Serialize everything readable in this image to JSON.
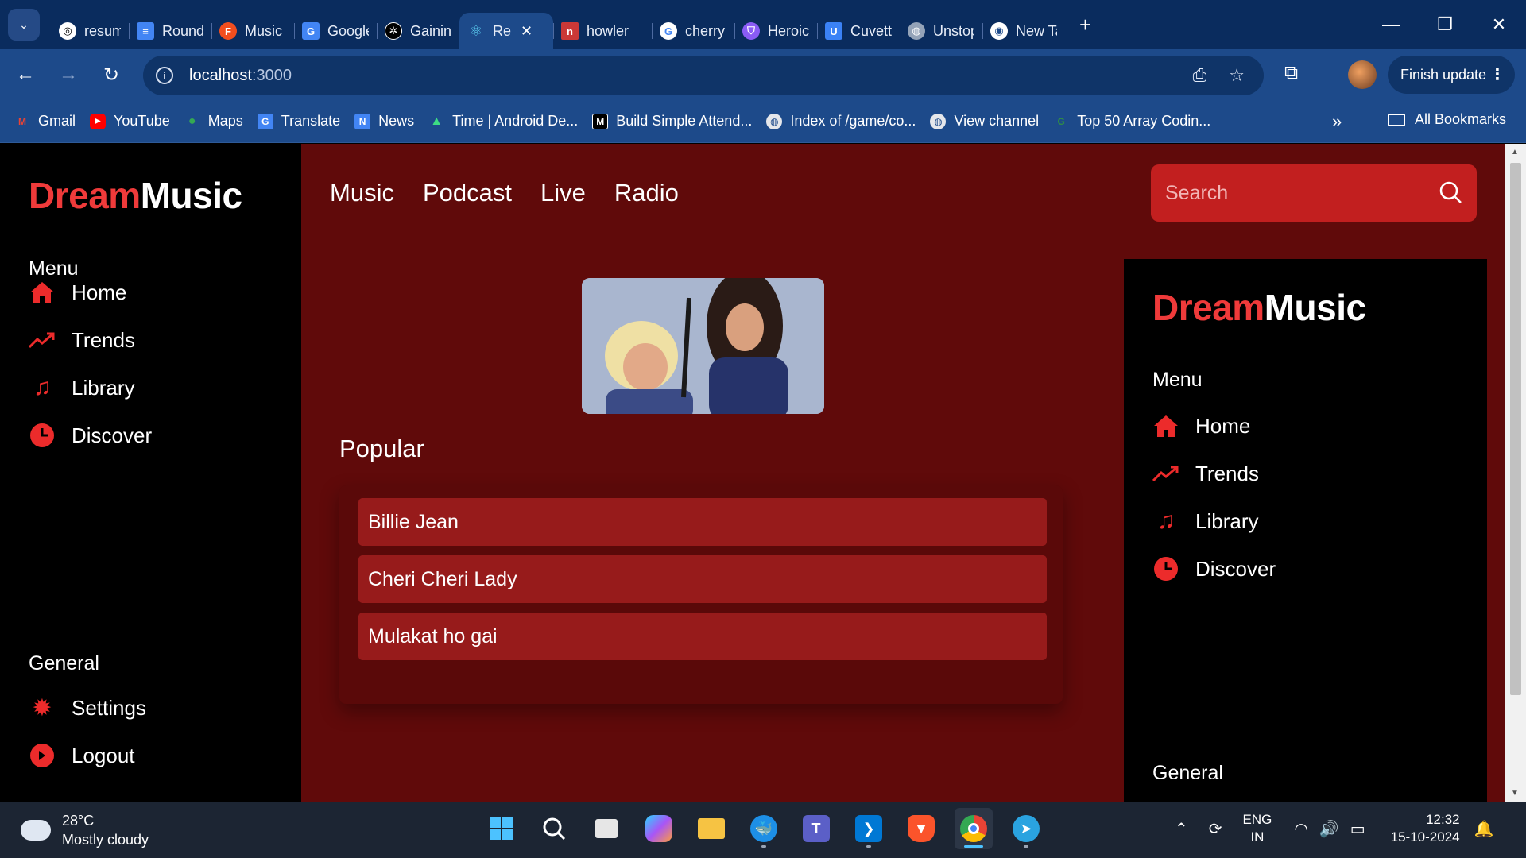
{
  "browser": {
    "tabs": [
      {
        "label": "resume",
        "favicon": "chatgpt-icon",
        "color": "#ffffff"
      },
      {
        "label": "Round",
        "favicon": "docs-icon",
        "color": "#4285f4"
      },
      {
        "label": "Music I",
        "favicon": "figma-icon",
        "color": "#f24e1e"
      },
      {
        "label": "Google",
        "favicon": "translate-icon",
        "color": "#4285f4"
      },
      {
        "label": "Gaining",
        "favicon": "openai-icon",
        "color": "#000000"
      },
      {
        "label": "Re",
        "favicon": "react-icon",
        "color": "#61dafb",
        "active": true
      },
      {
        "label": "howler",
        "favicon": "npm-icon",
        "color": "#cb3837"
      },
      {
        "label": "cherry",
        "favicon": "google-icon",
        "color": "#ffffff"
      },
      {
        "label": "Heroic",
        "favicon": "shield-icon",
        "color": "#8a5cf6"
      },
      {
        "label": "Cuvette",
        "favicon": "cuvette-icon",
        "color": "#3b82f6"
      },
      {
        "label": "Unstop",
        "favicon": "globe-icon",
        "color": "#94a3b8"
      },
      {
        "label": "New Ta",
        "favicon": "chrome-icon",
        "color": "#ffffff"
      }
    ],
    "close_tab": "✕",
    "new_tab": "+",
    "window_controls": {
      "minimize": "—",
      "restore": "❐",
      "close": "✕"
    },
    "url_host": "localhost",
    "url_port": ":3000",
    "finish_update": "Finish update",
    "bookmarks": [
      {
        "label": "Gmail",
        "color": "#ea4335",
        "glyph": "M"
      },
      {
        "label": "YouTube",
        "color": "#ff0000",
        "glyph": "▶"
      },
      {
        "label": "Maps",
        "color": "#34a853",
        "glyph": "●"
      },
      {
        "label": "Translate",
        "color": "#4285f4",
        "glyph": "G"
      },
      {
        "label": "News",
        "color": "#4285f4",
        "glyph": "N"
      },
      {
        "label": "Time | Android De...",
        "color": "#3ddc84",
        "glyph": "A"
      },
      {
        "label": "Build Simple Attend...",
        "color": "#000000",
        "glyph": "M"
      },
      {
        "label": "Index of /game/co...",
        "color": "#e5e7eb",
        "glyph": "◍"
      },
      {
        "label": "View channel",
        "color": "#e5e7eb",
        "glyph": "◍"
      },
      {
        "label": "Top 50 Array Codin...",
        "color": "#2f8d46",
        "glyph": "G"
      }
    ],
    "bookmarks_more": "»",
    "all_bookmarks": "All Bookmarks"
  },
  "app": {
    "brand_part1": "Dream",
    "brand_part2": "Music",
    "menu_label": "Menu",
    "menu_items": [
      {
        "label": "Home",
        "icon": "home-icon"
      },
      {
        "label": "Trends",
        "icon": "trend-icon"
      },
      {
        "label": "Library",
        "icon": "music-note-icon"
      },
      {
        "label": "Discover",
        "icon": "clock-icon"
      }
    ],
    "general_label": "General",
    "general_items": [
      {
        "label": "Settings",
        "icon": "gear-icon"
      },
      {
        "label": "Logout",
        "icon": "logout-icon"
      }
    ],
    "top_nav": [
      "Music",
      "Podcast",
      "Live",
      "Radio"
    ],
    "search_placeholder": "Search",
    "popular_title": "Popular",
    "songs": [
      "Billie Jean",
      "Cheri Cheri Lady",
      "Mulakat ho gai"
    ],
    "colors": {
      "accent": "#ef3a3a",
      "main_bg": "#600a0a",
      "song_bg": "#971b1b",
      "search_bg": "#c21f1f"
    }
  },
  "taskbar": {
    "temperature": "28°C",
    "weather": "Mostly cloudy",
    "lang_line1": "ENG",
    "lang_line2": "IN",
    "time": "12:32",
    "date": "15-10-2024"
  }
}
